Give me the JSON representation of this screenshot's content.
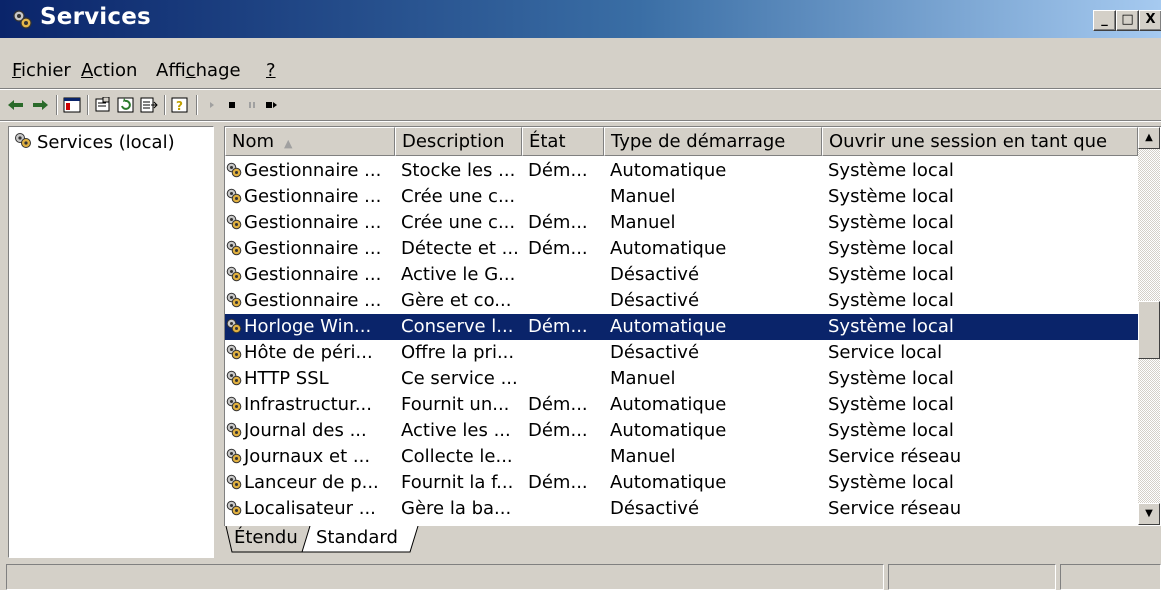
{
  "window": {
    "title": "Services",
    "minimize": "_",
    "maximize": "□",
    "close": "X"
  },
  "menu": {
    "items": [
      {
        "label": "Fichier",
        "accel": "F"
      },
      {
        "label": "Action",
        "accel": "A"
      },
      {
        "label": "Affichage",
        "accel": "c"
      },
      {
        "label": "?",
        "accel": "?"
      }
    ]
  },
  "toolbar": {
    "icons": [
      "back-arrow-icon",
      "forward-arrow-icon",
      "console-tree-icon",
      "properties-icon",
      "refresh-icon",
      "export-list-icon",
      "help-icon",
      "start-service-icon",
      "stop-service-icon",
      "pause-service-icon",
      "restart-service-icon"
    ]
  },
  "tree": {
    "root_label": "Services (local)"
  },
  "table": {
    "columns": [
      "Nom",
      "Description",
      "État",
      "Type de démarrage",
      "Ouvrir une session en tant que"
    ],
    "rows": [
      {
        "name": "Gestionnaire ...",
        "desc": "Stocke les ...",
        "state": "Dém...",
        "startup": "Automatique",
        "logon": "Système local"
      },
      {
        "name": "Gestionnaire ...",
        "desc": "Crée une c...",
        "state": "",
        "startup": "Manuel",
        "logon": "Système local"
      },
      {
        "name": "Gestionnaire ...",
        "desc": "Crée une c...",
        "state": "Dém...",
        "startup": "Manuel",
        "logon": "Système local"
      },
      {
        "name": "Gestionnaire ...",
        "desc": "Détecte et ...",
        "state": "Dém...",
        "startup": "Automatique",
        "logon": "Système local"
      },
      {
        "name": "Gestionnaire ...",
        "desc": "Active le G...",
        "state": "",
        "startup": "Désactivé",
        "logon": "Système local"
      },
      {
        "name": "Gestionnaire ...",
        "desc": "Gère et co...",
        "state": "",
        "startup": "Désactivé",
        "logon": "Système local"
      },
      {
        "name": "Horloge Win...",
        "desc": "Conserve l...",
        "state": "Dém...",
        "startup": "Automatique",
        "logon": "Système local",
        "selected": true
      },
      {
        "name": "Hôte de péri...",
        "desc": "Offre la pri...",
        "state": "",
        "startup": "Désactivé",
        "logon": "Service local"
      },
      {
        "name": "HTTP SSL",
        "desc": "Ce service ...",
        "state": "",
        "startup": "Manuel",
        "logon": "Système local"
      },
      {
        "name": "Infrastructur...",
        "desc": "Fournit un...",
        "state": "Dém...",
        "startup": "Automatique",
        "logon": "Système local"
      },
      {
        "name": "Journal des ...",
        "desc": "Active les ...",
        "state": "Dém...",
        "startup": "Automatique",
        "logon": "Système local"
      },
      {
        "name": "Journaux et ...",
        "desc": "Collecte le...",
        "state": "",
        "startup": "Manuel",
        "logon": "Service réseau"
      },
      {
        "name": "Lanceur de p...",
        "desc": "Fournit la f...",
        "state": "Dém...",
        "startup": "Automatique",
        "logon": "Système local"
      },
      {
        "name": "Localisateur ...",
        "desc": "Gère la ba...",
        "state": "",
        "startup": "Désactivé",
        "logon": "Service réseau"
      }
    ]
  },
  "tabs": {
    "extended": "Étendu",
    "standard": "Standard"
  }
}
